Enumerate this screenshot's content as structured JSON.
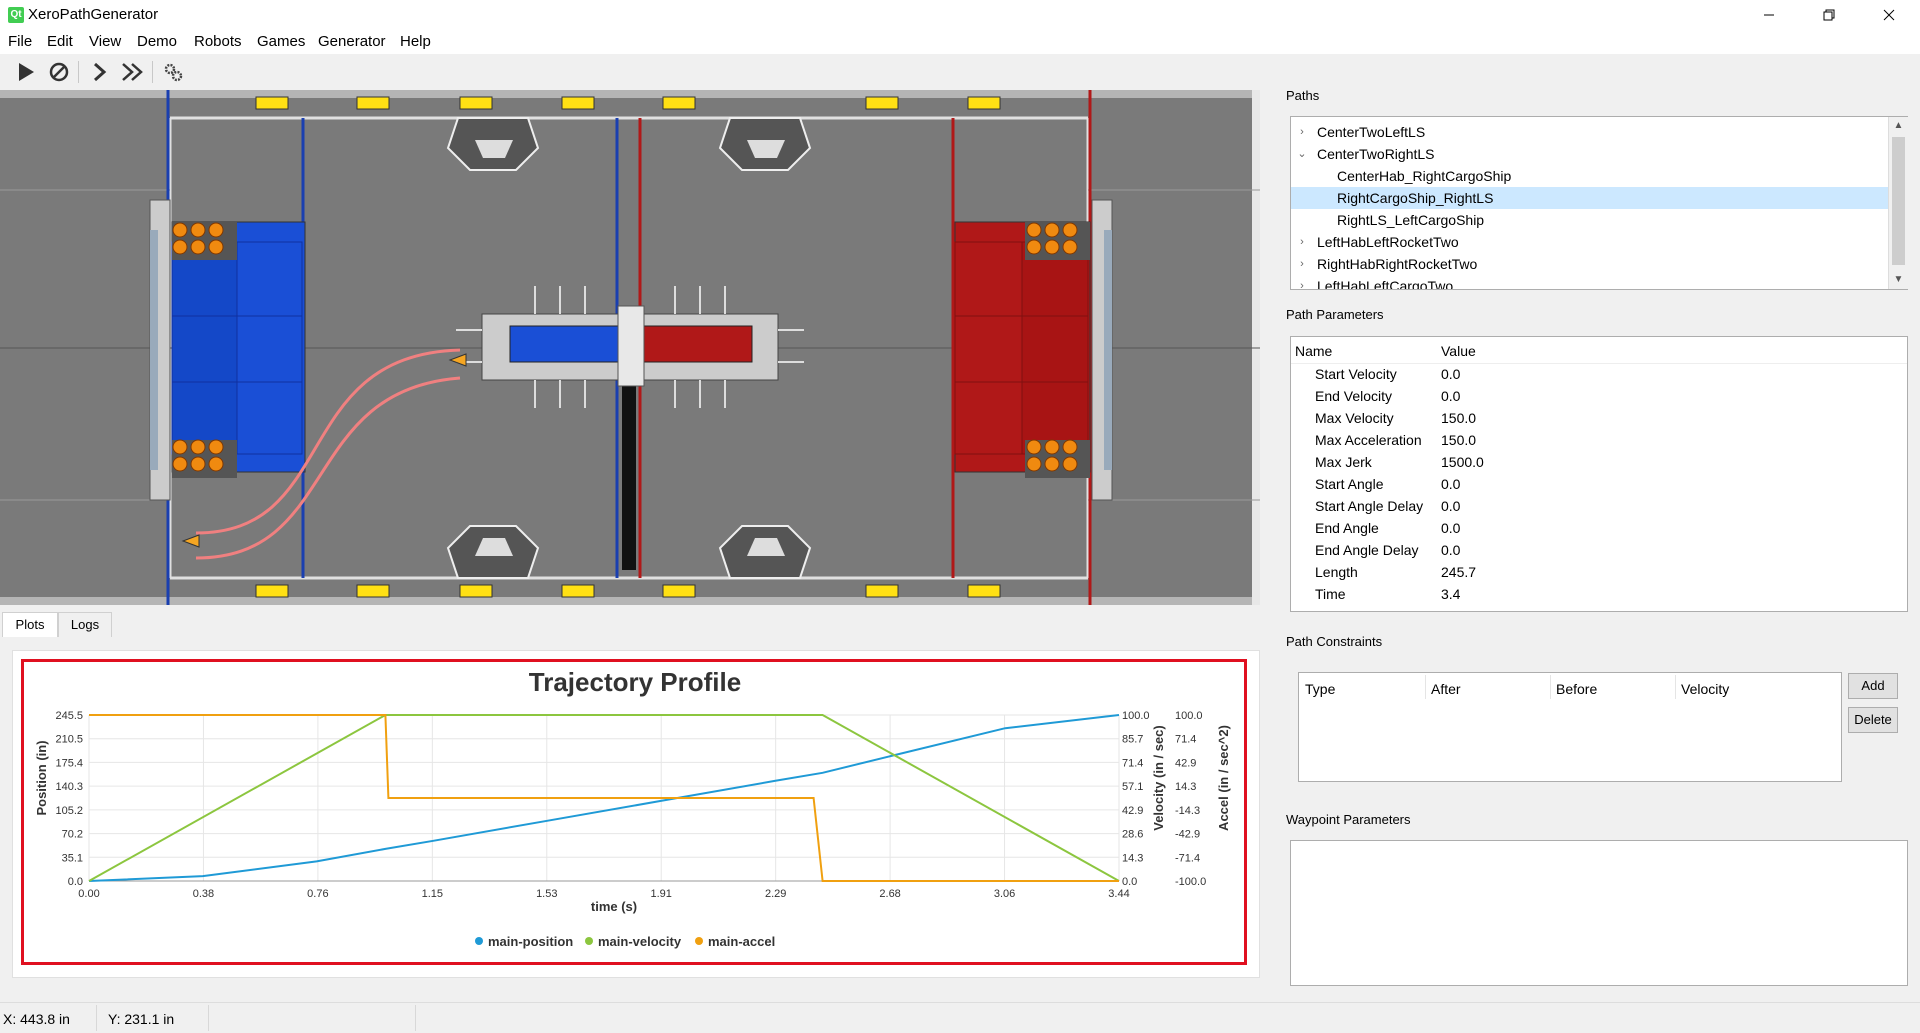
{
  "window": {
    "title": "XeroPathGenerator",
    "app_icon": "Qt"
  },
  "menubar": {
    "items": [
      "File",
      "Edit",
      "View",
      "Demo",
      "Robots",
      "Games",
      "Generator",
      "Help"
    ]
  },
  "toolbar": {
    "icons": [
      "play-icon",
      "stop-icon",
      "step-icon",
      "fast-forward-icon",
      "settings-icon"
    ]
  },
  "tabs": [
    "Plots",
    "Logs"
  ],
  "plot": {
    "title": "Trajectory Profile",
    "xlabel": "time (s)",
    "ylabel_left": "Position (in)",
    "ylabel_mid": "Velocity (in / sec)",
    "ylabel_right": "Accel (in / sec^2)",
    "x_ticks": [
      "0.00",
      "0.38",
      "0.76",
      "1.15",
      "1.53",
      "1.91",
      "2.29",
      "2.68",
      "3.06",
      "3.44"
    ],
    "y_left_ticks": [
      "0.0",
      "35.1",
      "70.2",
      "105.2",
      "140.3",
      "175.4",
      "210.5",
      "245.5"
    ],
    "y_mid_ticks": [
      "0.0",
      "14.3",
      "28.6",
      "42.9",
      "57.1",
      "71.4",
      "85.7",
      "100.0"
    ],
    "y_right_ticks": [
      "-100.0",
      "-71.4",
      "-42.9",
      "-14.3",
      "14.3",
      "42.9",
      "71.4",
      "100.0"
    ],
    "legend": [
      "main-position",
      "main-velocity",
      "main-accel"
    ]
  },
  "chart_data": {
    "type": "line",
    "title": "Trajectory Profile",
    "xlabel": "time (s)",
    "xlim": [
      0,
      3.44
    ],
    "series": [
      {
        "name": "main-position",
        "axis": "left",
        "ylim": [
          0,
          245.5
        ],
        "color": "#1f9ad6",
        "x": [
          0,
          0.38,
          0.76,
          0.99,
          1.15,
          1.53,
          1.91,
          2.29,
          2.45,
          2.68,
          3.06,
          3.44
        ],
        "y": [
          0,
          7.2,
          29,
          47.5,
          59.5,
          89,
          118.5,
          148,
          160,
          185,
          226,
          245.5
        ]
      },
      {
        "name": "main-velocity",
        "axis": "mid",
        "ylim": [
          0,
          100
        ],
        "color": "#8cc63f",
        "x": [
          0,
          0.99,
          2.45,
          3.44
        ],
        "y": [
          0,
          100,
          100,
          0
        ]
      },
      {
        "name": "main-accel",
        "axis": "right",
        "ylim": [
          -100,
          100
        ],
        "color": "#f0a010",
        "x": [
          0,
          0.99,
          1.0,
          2.42,
          2.45,
          3.44
        ],
        "y": [
          100,
          100,
          0,
          0,
          -100,
          -100
        ]
      }
    ]
  },
  "paths": {
    "label": "Paths",
    "items": [
      {
        "label": "CenterTwoLeftLS",
        "level": 0,
        "arrow": "›",
        "selected": false
      },
      {
        "label": "CenterTwoRightLS",
        "level": 0,
        "arrow": "⌄",
        "selected": false
      },
      {
        "label": "CenterHab_RightCargoShip",
        "level": 1,
        "arrow": "",
        "selected": false
      },
      {
        "label": "RightCargoShip_RightLS",
        "level": 1,
        "arrow": "",
        "selected": true
      },
      {
        "label": "RightLS_LeftCargoShip",
        "level": 1,
        "arrow": "",
        "selected": false
      },
      {
        "label": "LeftHabLeftRocketTwo",
        "level": 0,
        "arrow": "›",
        "selected": false
      },
      {
        "label": "RightHabRightRocketTwo",
        "level": 0,
        "arrow": "›",
        "selected": false
      },
      {
        "label": "LeftHabLeftCargoTwo",
        "level": 0,
        "arrow": "›",
        "selected": false
      }
    ]
  },
  "path_parameters": {
    "label": "Path Parameters",
    "headers": [
      "Name",
      "Value"
    ],
    "rows": [
      {
        "name": "Start Velocity",
        "value": "0.0"
      },
      {
        "name": "End Velocity",
        "value": "0.0"
      },
      {
        "name": "Max Velocity",
        "value": "150.0"
      },
      {
        "name": "Max Acceleration",
        "value": "150.0"
      },
      {
        "name": "Max Jerk",
        "value": "1500.0"
      },
      {
        "name": "Start Angle",
        "value": "0.0"
      },
      {
        "name": "Start Angle Delay",
        "value": "0.0"
      },
      {
        "name": "End Angle",
        "value": "0.0"
      },
      {
        "name": "End Angle Delay",
        "value": "0.0"
      },
      {
        "name": "Length",
        "value": "245.7"
      },
      {
        "name": "Time",
        "value": "3.4"
      }
    ]
  },
  "path_constraints": {
    "label": "Path Constraints",
    "headers": [
      "Type",
      "After",
      "Before",
      "Velocity"
    ],
    "add_label": "Add",
    "delete_label": "Delete"
  },
  "waypoint_parameters": {
    "label": "Waypoint Parameters"
  },
  "status": {
    "x": "X: 443.8 in",
    "y": "Y: 231.1 in"
  },
  "colors": {
    "blue_alliance": "#1a4fd6",
    "red_alliance": "#b01818",
    "path": "#f08080",
    "highlight": "#e01020",
    "selection": "#cce8ff"
  }
}
